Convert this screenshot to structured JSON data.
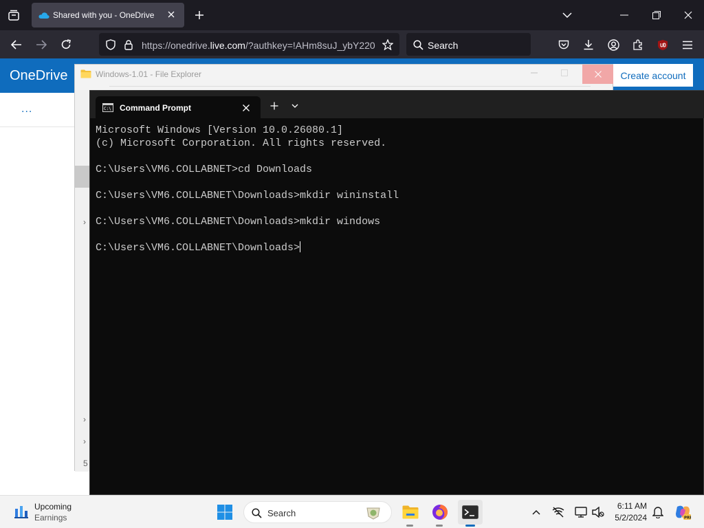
{
  "browser": {
    "tab_title": "Shared with you - OneDrive",
    "url_prefix": "https://onedrive.",
    "url_domain": "live.com",
    "url_rest": "/?authkey=!AHm8suJ_ybY220",
    "search_placeholder": "Search"
  },
  "onedrive": {
    "brand": "OneDrive",
    "create_account": "Create account",
    "more": "..."
  },
  "explorer": {
    "title": "Windows-1.01 - File Explorer",
    "status_number": "5"
  },
  "cmd": {
    "tab_title": "Command Prompt",
    "lines": [
      "Microsoft Windows [Version 10.0.26080.1]",
      "(c) Microsoft Corporation. All rights reserved.",
      "",
      "C:\\Users\\VM6.COLLABNET>cd Downloads",
      "",
      "C:\\Users\\VM6.COLLABNET\\Downloads>mkdir wininstall",
      "",
      "C:\\Users\\VM6.COLLABNET\\Downloads>mkdir windows",
      "",
      "C:\\Users\\VM6.COLLABNET\\Downloads>"
    ]
  },
  "taskbar": {
    "widget_title": "Upcoming",
    "widget_subtitle": "Earnings",
    "search_label": "Search",
    "time": "6:11 AM",
    "date": "5/2/2024"
  },
  "colors": {
    "onedrive_blue": "#0f6cbd",
    "firefox_chrome": "#2b2a33",
    "terminal_bg": "#0c0c0c"
  }
}
